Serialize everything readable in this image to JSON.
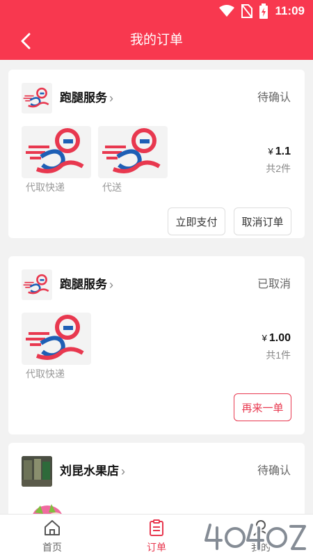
{
  "status_bar": {
    "time": "11:09"
  },
  "header": {
    "title": "我的订单"
  },
  "orders": [
    {
      "store": "跑腿服务",
      "status": "待确认",
      "items": [
        {
          "label": "代取快递"
        },
        {
          "label": "代送"
        }
      ],
      "currency": "¥",
      "price": "1.1",
      "count": "共2件",
      "actions": [
        "立即支付",
        "取消订单"
      ]
    },
    {
      "store": "跑腿服务",
      "status": "已取消",
      "items": [
        {
          "label": "代取快递"
        }
      ],
      "currency": "¥",
      "price": "1.00",
      "count": "共1件",
      "actions": [
        "再来一单"
      ]
    },
    {
      "store": "刘昆水果店",
      "status": "待确认"
    }
  ],
  "tabbar": {
    "tabs": [
      {
        "label": "首页",
        "icon": "home-icon"
      },
      {
        "label": "订单",
        "icon": "order-icon",
        "active": true
      },
      {
        "label": "我的",
        "icon": "user-icon"
      }
    ]
  },
  "colors": {
    "brand": "#f8384f",
    "accent": "#e8384f"
  }
}
